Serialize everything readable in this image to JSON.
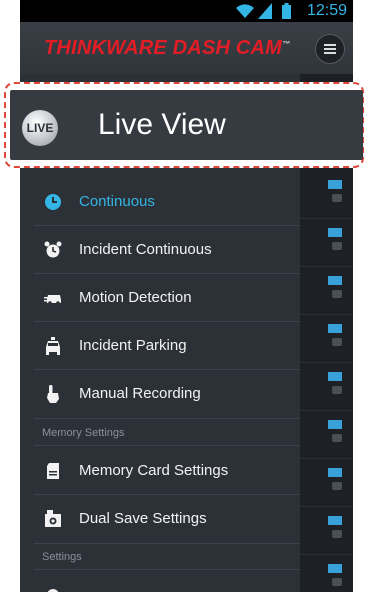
{
  "status_bar": {
    "time": "12:59",
    "icons": [
      "wifi-icon",
      "signal-icon",
      "battery-icon"
    ]
  },
  "app_bar": {
    "title": "THINKWARE DASH CAM",
    "title_mark": "™",
    "menu_icon": "menu-icon"
  },
  "highlight": {
    "badge": "LIVE",
    "label": "Live View"
  },
  "drawer": {
    "items": [
      {
        "label": "Continuous",
        "icon": "clock-icon",
        "active": true
      },
      {
        "label": "Incident Continuous",
        "icon": "alarm-clock-icon",
        "active": false
      },
      {
        "label": "Motion Detection",
        "icon": "car-motion-icon",
        "active": false
      },
      {
        "label": "Incident Parking",
        "icon": "car-front-icon",
        "active": false
      },
      {
        "label": "Manual Recording",
        "icon": "hand-pointer-icon",
        "active": false
      }
    ],
    "memory_section": "Memory Settings",
    "memory_items": [
      {
        "label": "Memory Card Settings",
        "icon": "sd-card-icon"
      },
      {
        "label": "Dual Save Settings",
        "icon": "dual-save-icon"
      }
    ],
    "settings_section": "Settings"
  },
  "colors": {
    "accent": "#33b5e5",
    "brand": "#e21d25",
    "highlight_border": "#e0473a"
  }
}
